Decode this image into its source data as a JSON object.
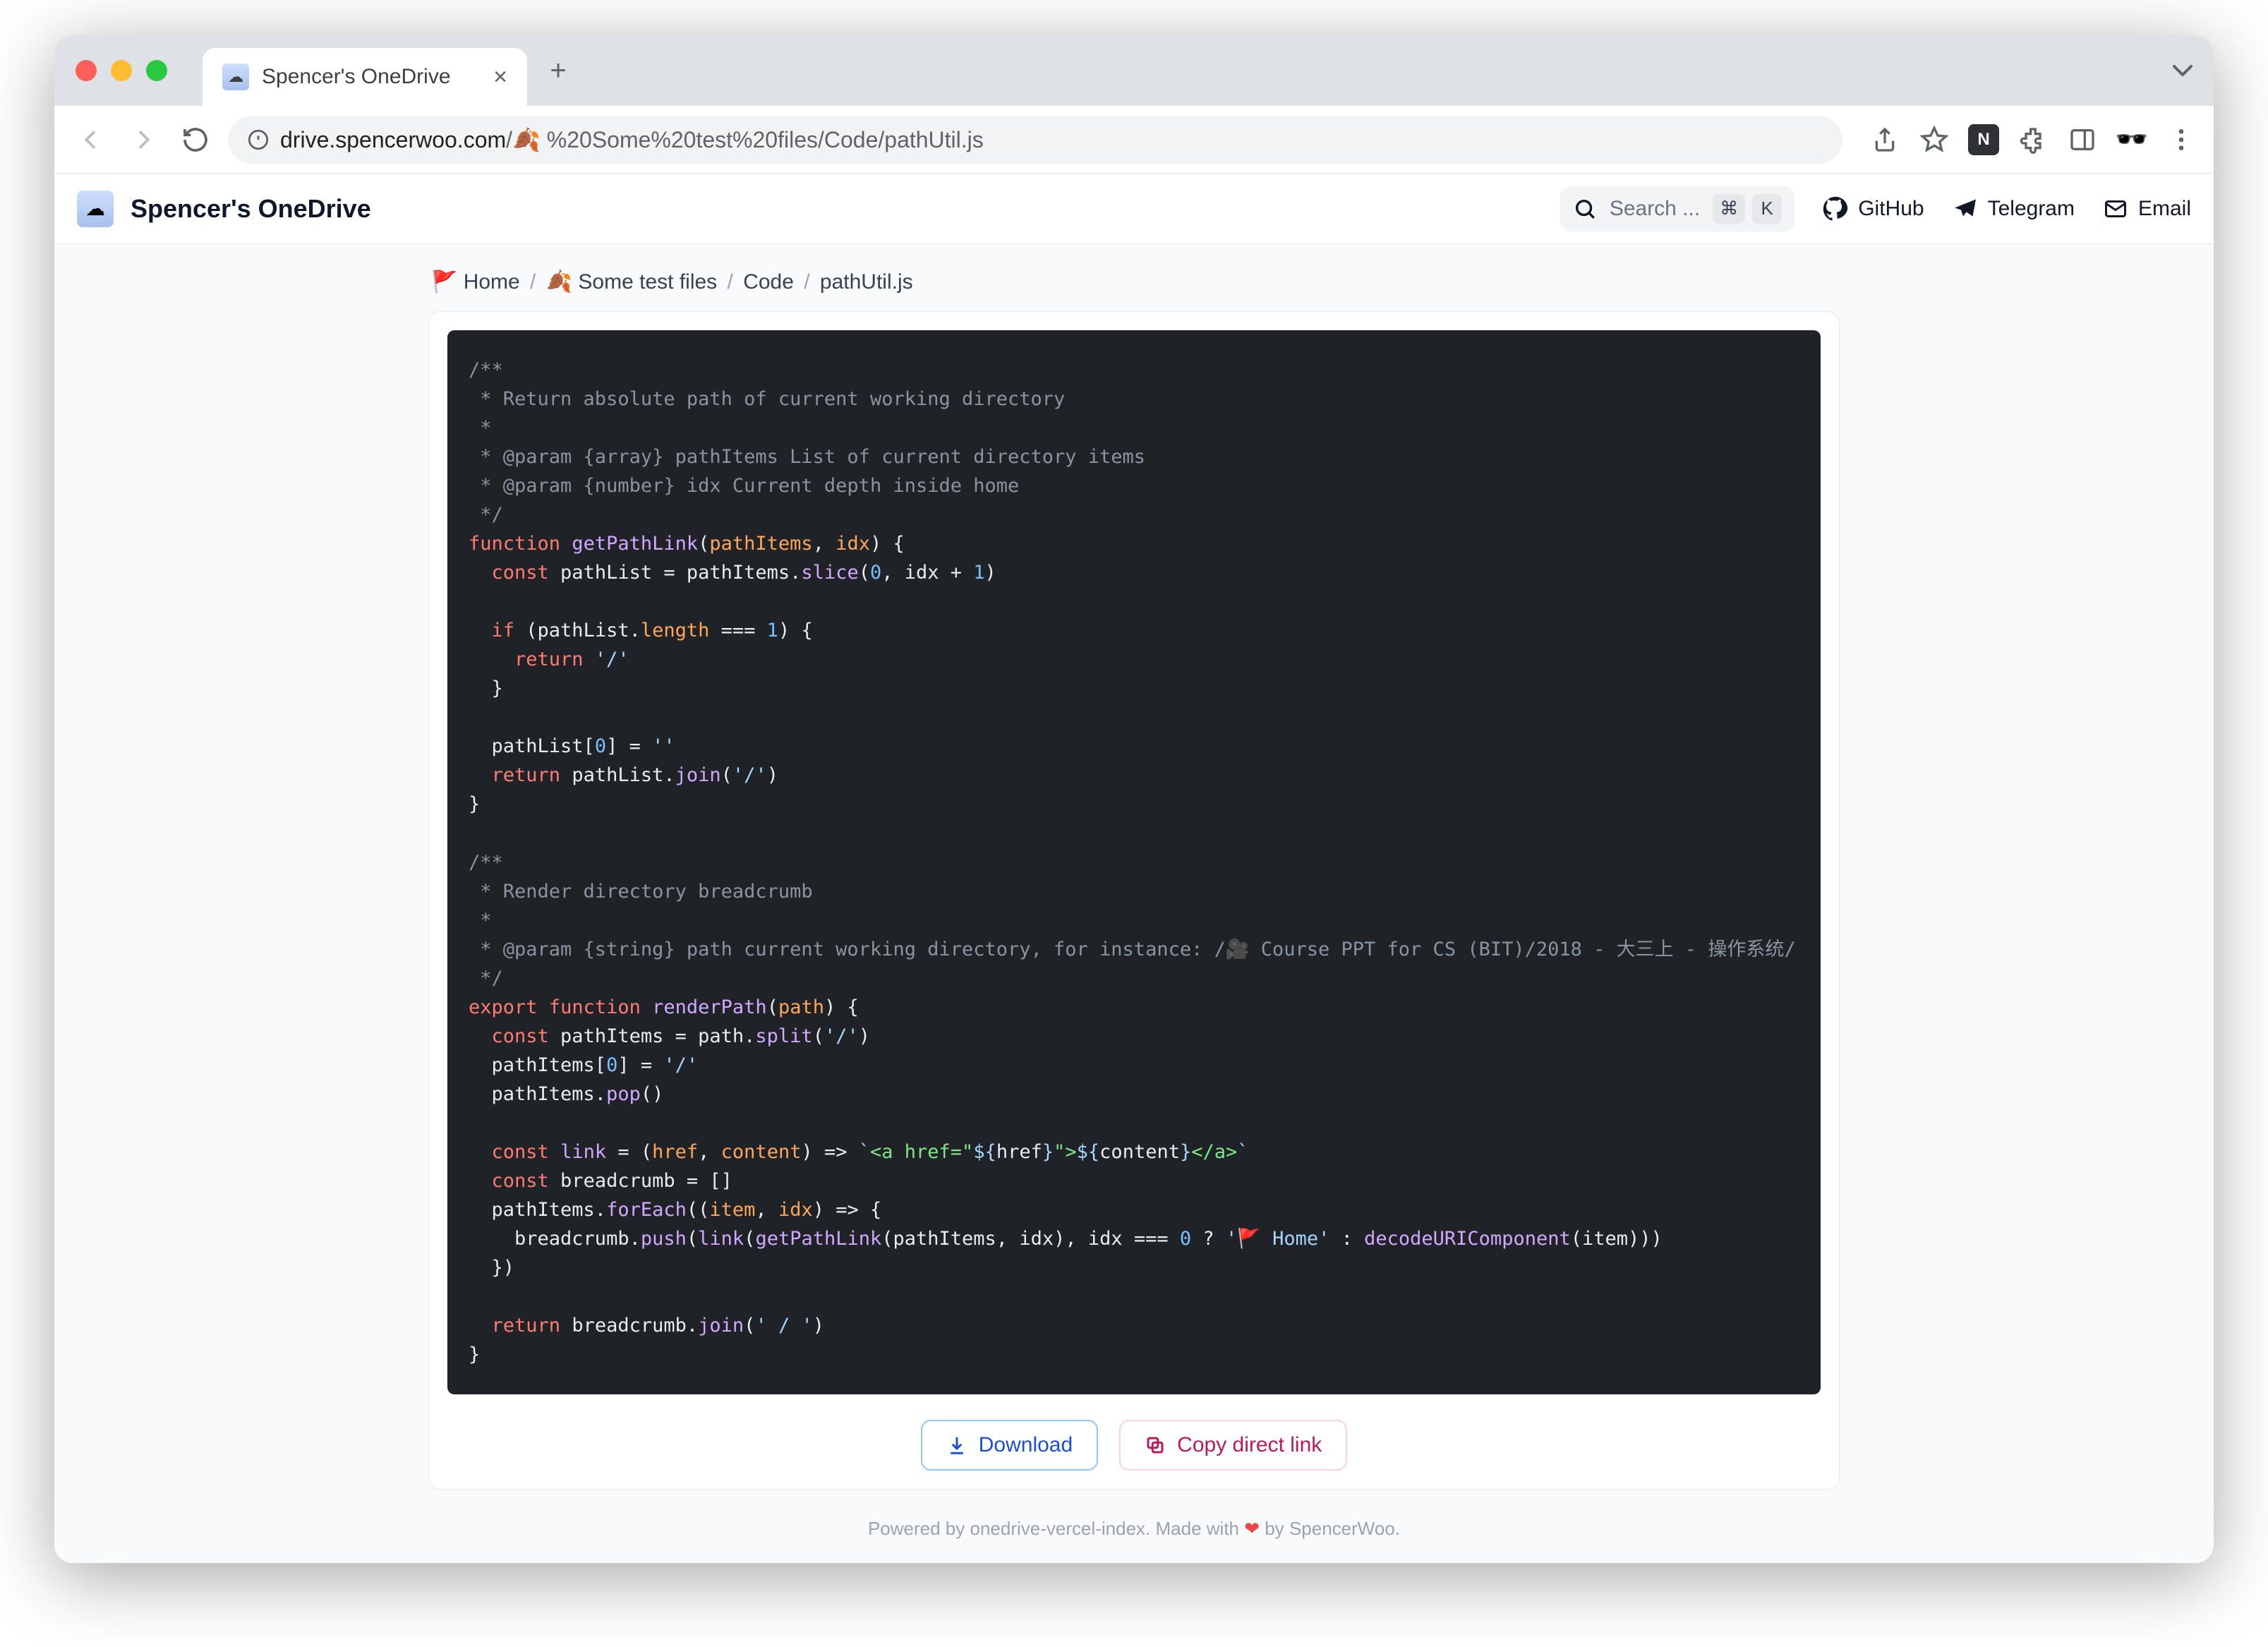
{
  "browser": {
    "tab_title": "Spencer's OneDrive",
    "url_host": "drive.spencerwoo.com",
    "url_path_prefix": "/🍂 ",
    "url_path_rest": "%20Some%20test%20files/Code/pathUtil.js"
  },
  "app": {
    "title": "Spencer's OneDrive",
    "search_placeholder": "Search ...",
    "kbd_mod": "⌘",
    "kbd_key": "K",
    "links": {
      "github": "GitHub",
      "telegram": "Telegram",
      "email": "Email"
    }
  },
  "breadcrumb": [
    {
      "icon": "🚩",
      "label": "Home"
    },
    {
      "icon": "🍂",
      "label": "Some test files"
    },
    {
      "icon": "",
      "label": "Code"
    },
    {
      "icon": "",
      "label": "pathUtil.js"
    }
  ],
  "buttons": {
    "download": "Download",
    "copy_link": "Copy direct link"
  },
  "footer": {
    "text_a": "Powered by ",
    "link_a": "onedrive-vercel-index",
    "text_b": ". Made with ",
    "heart": "❤",
    "text_c": " by ",
    "author": "SpencerWoo",
    "text_d": "."
  },
  "code": {
    "lines": [
      [
        [
          "c",
          "/**"
        ]
      ],
      [
        [
          "c",
          " * Return absolute path of current working directory"
        ]
      ],
      [
        [
          "c",
          " *"
        ]
      ],
      [
        [
          "c",
          " * @param {array} pathItems List of current directory items"
        ]
      ],
      [
        [
          "c",
          " * @param {number} idx Current depth inside home"
        ]
      ],
      [
        [
          "c",
          " */"
        ]
      ],
      [
        [
          "k",
          "function"
        ],
        [
          "d",
          " "
        ],
        [
          "f",
          "getPathLink"
        ],
        [
          "d",
          "("
        ],
        [
          "p",
          "pathItems"
        ],
        [
          "d",
          ", "
        ],
        [
          "p",
          "idx"
        ],
        [
          "d",
          ") {"
        ]
      ],
      [
        [
          "d",
          "  "
        ],
        [
          "k",
          "const"
        ],
        [
          "d",
          " pathList = pathItems."
        ],
        [
          "f",
          "slice"
        ],
        [
          "d",
          "("
        ],
        [
          "n",
          "0"
        ],
        [
          "d",
          ", idx + "
        ],
        [
          "n",
          "1"
        ],
        [
          "d",
          ")"
        ]
      ],
      [
        [
          "d",
          ""
        ]
      ],
      [
        [
          "d",
          "  "
        ],
        [
          "k",
          "if"
        ],
        [
          "d",
          " (pathList."
        ],
        [
          "p",
          "length"
        ],
        [
          "d",
          " === "
        ],
        [
          "n",
          "1"
        ],
        [
          "d",
          ") {"
        ]
      ],
      [
        [
          "d",
          "    "
        ],
        [
          "k",
          "return"
        ],
        [
          "d",
          " "
        ],
        [
          "s",
          "'/'"
        ]
      ],
      [
        [
          "d",
          "  }"
        ]
      ],
      [
        [
          "d",
          ""
        ]
      ],
      [
        [
          "d",
          "  pathList["
        ],
        [
          "n",
          "0"
        ],
        [
          "d",
          "] = "
        ],
        [
          "s",
          "''"
        ]
      ],
      [
        [
          "d",
          "  "
        ],
        [
          "k",
          "return"
        ],
        [
          "d",
          " pathList."
        ],
        [
          "f",
          "join"
        ],
        [
          "d",
          "("
        ],
        [
          "s",
          "'/'"
        ],
        [
          "d",
          ")"
        ]
      ],
      [
        [
          "d",
          "}"
        ]
      ],
      [
        [
          "d",
          ""
        ]
      ],
      [
        [
          "c",
          "/**"
        ]
      ],
      [
        [
          "c",
          " * Render directory breadcrumb"
        ]
      ],
      [
        [
          "c",
          " *"
        ]
      ],
      [
        [
          "c",
          " * @param {string} path current working directory, for instance: /🎥 Course PPT for CS (BIT)/2018 - 大三上 - 操作系统/"
        ]
      ],
      [
        [
          "c",
          " */"
        ]
      ],
      [
        [
          "k",
          "export"
        ],
        [
          "d",
          " "
        ],
        [
          "k",
          "function"
        ],
        [
          "d",
          " "
        ],
        [
          "f",
          "renderPath"
        ],
        [
          "d",
          "("
        ],
        [
          "p",
          "path"
        ],
        [
          "d",
          ") {"
        ]
      ],
      [
        [
          "d",
          "  "
        ],
        [
          "k",
          "const"
        ],
        [
          "d",
          " pathItems = path."
        ],
        [
          "f",
          "split"
        ],
        [
          "d",
          "("
        ],
        [
          "s",
          "'/'"
        ],
        [
          "d",
          ")"
        ]
      ],
      [
        [
          "d",
          "  pathItems["
        ],
        [
          "n",
          "0"
        ],
        [
          "d",
          "] = "
        ],
        [
          "s",
          "'/'"
        ]
      ],
      [
        [
          "d",
          "  pathItems."
        ],
        [
          "f",
          "pop"
        ],
        [
          "d",
          "()"
        ]
      ],
      [
        [
          "d",
          ""
        ]
      ],
      [
        [
          "d",
          "  "
        ],
        [
          "k",
          "const"
        ],
        [
          "d",
          " "
        ],
        [
          "f",
          "link"
        ],
        [
          "d",
          " = ("
        ],
        [
          "p",
          "href"
        ],
        [
          "d",
          ", "
        ],
        [
          "p",
          "content"
        ],
        [
          "d",
          ") => "
        ],
        [
          "s",
          "`"
        ],
        [
          "t",
          "<a href=\""
        ],
        [
          "s",
          "${"
        ],
        [
          "d",
          "href"
        ],
        [
          "s",
          "}"
        ],
        [
          "t",
          "\">"
        ],
        [
          "s",
          "${"
        ],
        [
          "d",
          "content"
        ],
        [
          "s",
          "}"
        ],
        [
          "t",
          "</a>"
        ],
        [
          "s",
          "`"
        ]
      ],
      [
        [
          "d",
          "  "
        ],
        [
          "k",
          "const"
        ],
        [
          "d",
          " breadcrumb = []"
        ]
      ],
      [
        [
          "d",
          "  pathItems."
        ],
        [
          "f",
          "forEach"
        ],
        [
          "d",
          "(("
        ],
        [
          "p",
          "item"
        ],
        [
          "d",
          ", "
        ],
        [
          "p",
          "idx"
        ],
        [
          "d",
          ") => {"
        ]
      ],
      [
        [
          "d",
          "    breadcrumb."
        ],
        [
          "f",
          "push"
        ],
        [
          "d",
          "("
        ],
        [
          "f",
          "link"
        ],
        [
          "d",
          "("
        ],
        [
          "f",
          "getPathLink"
        ],
        [
          "d",
          "(pathItems, idx), idx === "
        ],
        [
          "n",
          "0"
        ],
        [
          "d",
          " ? "
        ],
        [
          "s",
          "'🚩 Home'"
        ],
        [
          "d",
          " : "
        ],
        [
          "f",
          "decodeURIComponent"
        ],
        [
          "d",
          "(item)))"
        ]
      ],
      [
        [
          "d",
          "  })"
        ]
      ],
      [
        [
          "d",
          ""
        ]
      ],
      [
        [
          "d",
          "  "
        ],
        [
          "k",
          "return"
        ],
        [
          "d",
          " breadcrumb."
        ],
        [
          "f",
          "join"
        ],
        [
          "d",
          "("
        ],
        [
          "s",
          "' / '"
        ],
        [
          "d",
          ")"
        ]
      ],
      [
        [
          "d",
          "}"
        ]
      ]
    ]
  }
}
